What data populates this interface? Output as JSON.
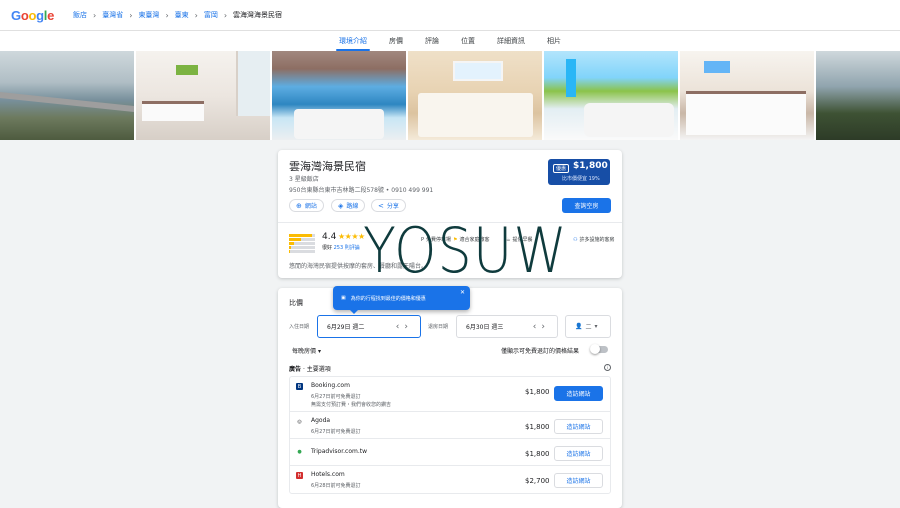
{
  "header": {
    "logo_letters": [
      "G",
      "o",
      "o",
      "g",
      "l",
      "e"
    ],
    "logo_colors": [
      "#4285f4",
      "#ea4335",
      "#fbbc04",
      "#4285f4",
      "#34a853",
      "#ea4335"
    ],
    "breadcrumbs": [
      "飯店",
      "臺灣省",
      "東臺灣",
      "臺東",
      "富岡",
      "雲海灣海景民宿"
    ]
  },
  "tabs": [
    "環境介紹",
    "房價",
    "評論",
    "位置",
    "詳細資訊",
    "相片"
  ],
  "active_tab": "環境介紹",
  "hotel": {
    "name": "雲海灣海景民宿",
    "class": "3 星級飯店",
    "address": "950台東縣台東市吉林路二段578號 • 0910 499 991",
    "deal_tag": "優惠",
    "price": "$1,800",
    "price_note": "比市價便宜 19%",
    "website_label": "網站",
    "route_label": "路線",
    "share_label": "分享",
    "check_label": "查詢空房",
    "rating": "4.4",
    "stars": "★★★★",
    "rating_text": "很好",
    "reviews": "253 則評論",
    "features": [
      "免費停車場",
      "適合家庭旅客",
      "提供早餐",
      "許多設施的客房"
    ],
    "description": "悠閒的海灣民宿提供按摩的套房、餐廳和露天陽台。"
  },
  "pricing": {
    "title": "比價",
    "tooltip": "為你的行程找到最佳的價格和優惠",
    "checkin_label": "入住日期",
    "checkin_value": "6月29日 週二",
    "checkout_label": "退房日期",
    "checkout_value": "6月30日 週三",
    "guests": "二",
    "nightly_label": "每晚房價",
    "free_cancel_label": "僅顯示可免費退訂的價格結果",
    "ads_label": "廣告",
    "main_options_label": "· 主要選項",
    "providers": [
      {
        "logo": "B",
        "logo_color": "#003580",
        "name": "Booking.com",
        "note": "6月27日前可免費退訂",
        "note2": "無需支付預訂費・我們會收您的鑽吉",
        "price": "$1,800",
        "button": "造訪網站",
        "primary": true
      },
      {
        "logo": "◎",
        "logo_color": "#ffffff",
        "name": "Agoda",
        "note": "6月27日前可免費退訂",
        "price": "$1,800",
        "button": "造訪網站",
        "primary": false
      },
      {
        "logo": "●",
        "logo_color": "#ffffff",
        "name": "Tripadvisor.com.tw",
        "note": "",
        "price": "$1,800",
        "button": "造訪網站",
        "primary": false
      },
      {
        "logo": "H",
        "logo_color": "#d32f2f",
        "name": "Hotels.com",
        "note": "6月28日前可免費退訂",
        "price": "$2,700",
        "button": "造訪網站",
        "primary": false
      }
    ]
  },
  "watermark": "YOSUW"
}
